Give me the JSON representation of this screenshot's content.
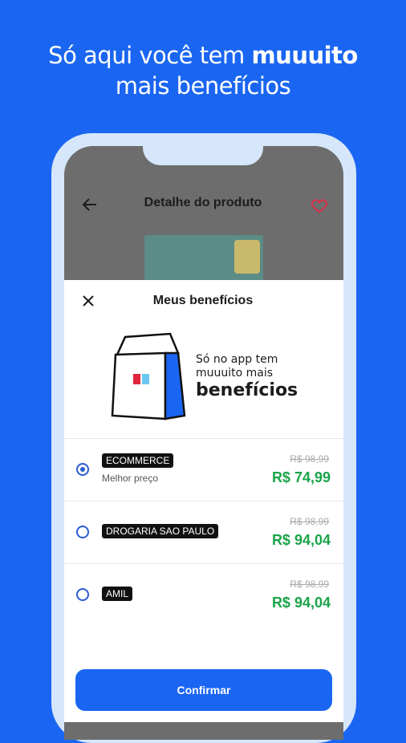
{
  "headline": {
    "line1": "Só aqui você tem ",
    "bold": "muuuito",
    "line2": "mais benefícios"
  },
  "appbar": {
    "title": "Detalhe do produto"
  },
  "sheet": {
    "title": "Meus benefícios",
    "banner": {
      "line1": "Só no app tem",
      "line2": "muuuito mais",
      "line3": "benefícios"
    },
    "options": [
      {
        "tag": "ECOMMERCE",
        "subtitle": "Melhor preço",
        "old_price": "R$ 98,99",
        "price": "R$ 74,99",
        "selected": true
      },
      {
        "tag": "DROGARIA SAO PAULO",
        "subtitle": "",
        "old_price": "R$ 98,99",
        "price": "R$ 94,04",
        "selected": false
      },
      {
        "tag": "AMIL",
        "subtitle": "",
        "old_price": "R$ 98,99",
        "price": "R$ 94,04",
        "selected": false
      }
    ],
    "confirm_label": "Confirmar"
  },
  "colors": {
    "brand_blue": "#1a66f2",
    "price_green": "#1aa44a",
    "heart_red": "#d9304a"
  }
}
